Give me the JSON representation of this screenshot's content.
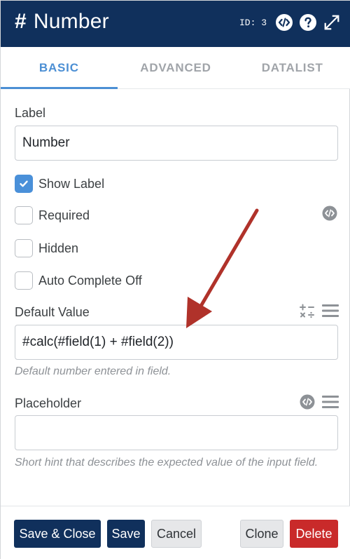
{
  "header": {
    "hash_symbol": "#",
    "title": "Number",
    "id_label": "ID: 3"
  },
  "tabs": [
    {
      "label": "BASIC",
      "active": true
    },
    {
      "label": "ADVANCED",
      "active": false
    },
    {
      "label": "DATALIST",
      "active": false
    }
  ],
  "label_field": {
    "label": "Label",
    "value": "Number"
  },
  "checkboxes": [
    {
      "label": "Show Label",
      "checked": true
    },
    {
      "label": "Required",
      "checked": false
    },
    {
      "label": "Hidden",
      "checked": false
    },
    {
      "label": "Auto Complete Off",
      "checked": false
    }
  ],
  "default_value": {
    "label": "Default Value",
    "value": "#calc(#field(1) + #field(2))",
    "help": "Default number entered in field."
  },
  "placeholder": {
    "label": "Placeholder",
    "value": "",
    "help": "Short hint that describes the expected value of the input field."
  },
  "footer": {
    "save_close": "Save & Close",
    "save": "Save",
    "cancel": "Cancel",
    "clone": "Clone",
    "delete": "Delete"
  },
  "colors": {
    "header_bg": "#10305c",
    "accent": "#4c8fd4",
    "danger": "#c92a2a",
    "annotation_arrow": "#b0322a"
  }
}
